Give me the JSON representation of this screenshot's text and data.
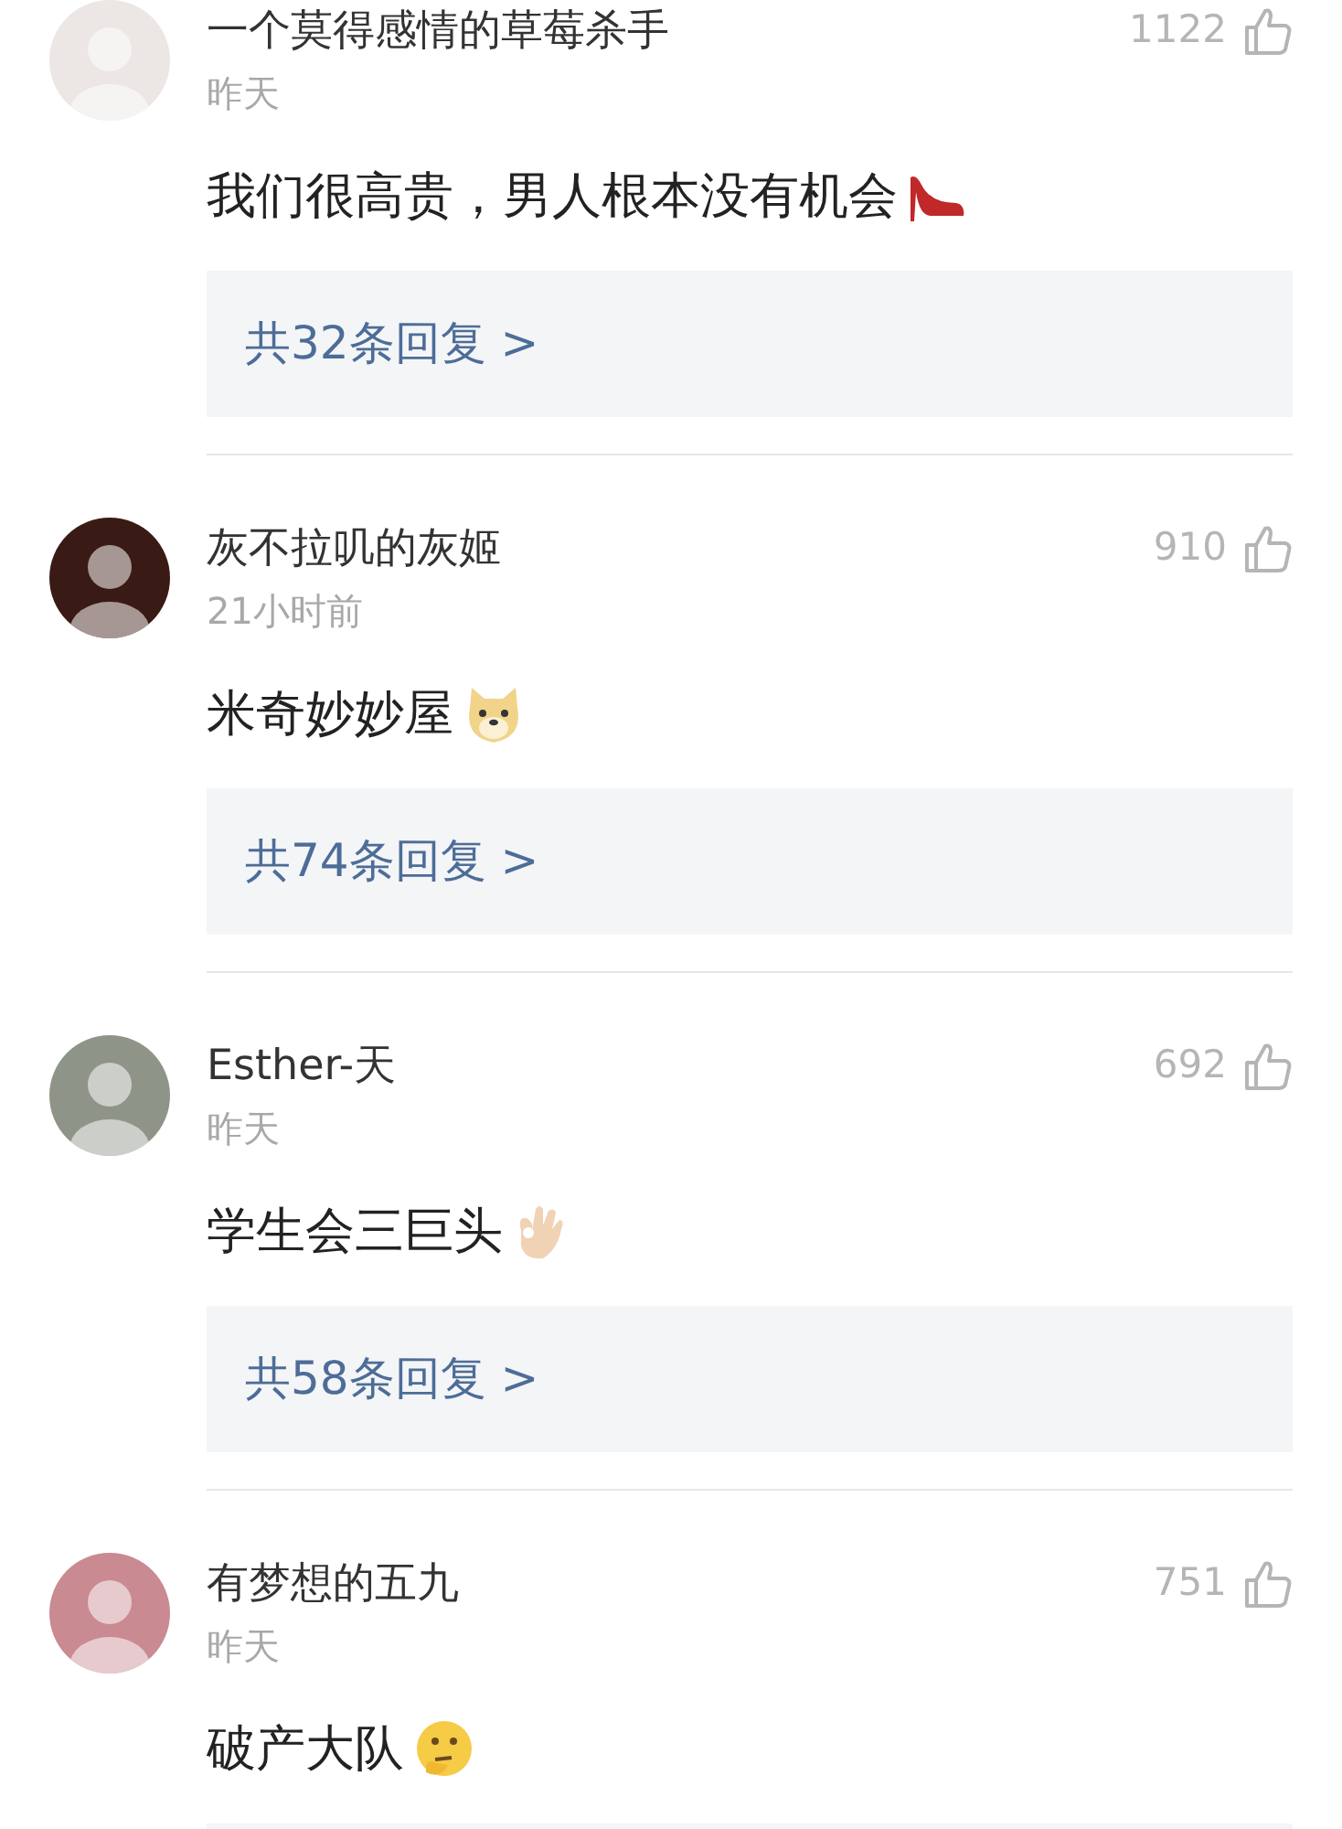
{
  "comments": [
    {
      "username": "一个莫得感情的草莓杀手",
      "time": "昨天",
      "likes": "1122",
      "text": "我们很高贵，男人根本没有机会",
      "kind": "heel",
      "replies": "共32条回复 >",
      "color": "#ece6e4"
    },
    {
      "username": "灰不拉叽的灰姬",
      "time": "21小时前",
      "likes": "910",
      "text": "米奇妙妙屋",
      "kind": "dog",
      "replies": "共74条回复 >",
      "color": "#3a1a14"
    },
    {
      "username": "Esther-天",
      "time": "昨天",
      "likes": "692",
      "text": "学生会三巨头",
      "kind": "ok",
      "replies": "共58条回复 >",
      "color": "#8f9488"
    },
    {
      "username": "有梦想的五九",
      "time": "昨天",
      "likes": "751",
      "text": "破产大队",
      "kind": "thinking",
      "color": "#c98a92"
    }
  ]
}
